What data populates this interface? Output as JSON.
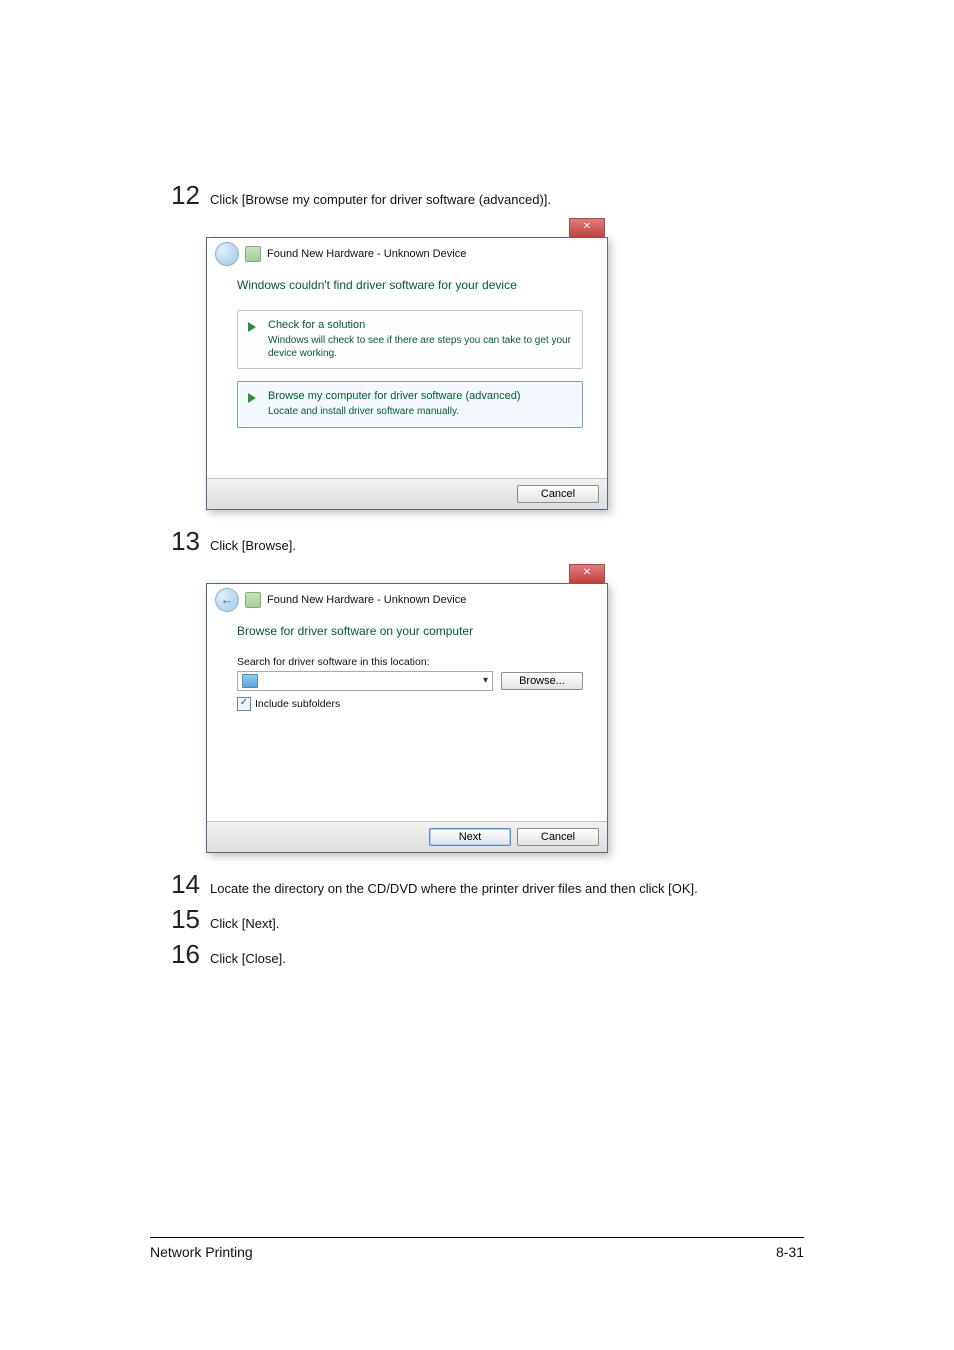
{
  "steps": {
    "s12": {
      "num": "12",
      "text": "Click [Browse my computer for driver software (advanced)]."
    },
    "s13": {
      "num": "13",
      "text": "Click [Browse]."
    },
    "s14": {
      "num": "14",
      "text": "Locate the directory on the CD/DVD where the printer driver files and then click [OK]."
    },
    "s15": {
      "num": "15",
      "text": "Click [Next]."
    },
    "s16": {
      "num": "16",
      "text": "Click [Close]."
    }
  },
  "dialog1": {
    "title": "Found New Hardware - Unknown Device",
    "heading": "Windows couldn't find driver software for your device",
    "option1": {
      "title": "Check for a solution",
      "desc": "Windows will check to see if there are steps you can take to get your device working."
    },
    "option2": {
      "title": "Browse my computer for driver software (advanced)",
      "desc": "Locate and install driver software manually."
    },
    "cancel": "Cancel"
  },
  "dialog2": {
    "title": "Found New Hardware - Unknown Device",
    "heading": "Browse for driver software on your computer",
    "search_label": "Search for driver software in this location:",
    "path_value": "",
    "browse_btn": "Browse...",
    "include_label": "Include subfolders",
    "next": "Next",
    "cancel": "Cancel"
  },
  "footer": {
    "left": "Network Printing",
    "right": "8-31"
  }
}
